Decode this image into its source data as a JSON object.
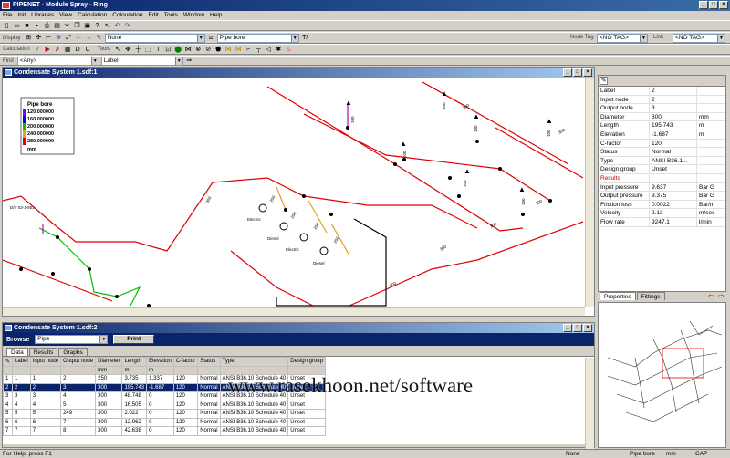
{
  "app": {
    "title": "PIPENET - Module Spray - Ring",
    "menu": [
      "File",
      "Init",
      "Libraries",
      "View",
      "Calculation",
      "Colouration",
      "Edit",
      "Tools",
      "Window",
      "Help"
    ]
  },
  "toolbar": {
    "display_label": "Display",
    "none_value": "None",
    "pipe_bore_value": "Pipe bore",
    "calculation_label": "Calculation",
    "tools_label": "Tools",
    "find_label": "Find",
    "any_value": "<Any>",
    "label_value": "Label",
    "node_tag_label": "Node Tag",
    "node_tag_value": "<NO TAG>",
    "link_label": "Link",
    "link_tag_value": "<NO TAG>"
  },
  "schematic": {
    "title": "Condensate System 1.sdf:1",
    "legend_title": "Pipe bore",
    "legend_values": [
      "120.000000",
      "160.000000",
      "200.000000",
      "240.000000",
      "280.000000"
    ],
    "legend_unit": "mm",
    "colors": {
      "red": "#e00000",
      "green": "#00c000",
      "orange": "#e0a020",
      "magenta": "#c000c0",
      "black": "#000000"
    },
    "labels": [
      "Electric",
      "Diesel",
      "Electric",
      "Diesel",
      "D/V 03-1-801"
    ],
    "pipe_numbers": [
      "300",
      "250",
      "250",
      "250",
      "250",
      "300",
      "300",
      "300",
      "300",
      "300",
      "300",
      "100",
      "100",
      "100",
      "100",
      "100",
      "100",
      "100"
    ]
  },
  "properties": {
    "rows": [
      {
        "k": "Label",
        "v": "2",
        "u": ""
      },
      {
        "k": "Input node",
        "v": "2",
        "u": ""
      },
      {
        "k": "Output node",
        "v": "3",
        "u": ""
      },
      {
        "k": "Diameter",
        "v": "300",
        "u": "mm"
      },
      {
        "k": "Length",
        "v": "195.743",
        "u": "m"
      },
      {
        "k": "Elevation",
        "v": "-1.687",
        "u": "m"
      },
      {
        "k": "C-factor",
        "v": "120",
        "u": ""
      },
      {
        "k": "Status",
        "v": "Normal",
        "u": ""
      },
      {
        "k": "Type",
        "v": "ANSI B36.1...",
        "u": ""
      },
      {
        "k": "Design group",
        "v": "Unset",
        "u": ""
      }
    ],
    "results_header": "Results",
    "results": [
      {
        "k": "Input pressure",
        "v": "9.637",
        "u": "Bar G"
      },
      {
        "k": "Output pressure",
        "v": "9.375",
        "u": "Bar G"
      },
      {
        "k": "Friction loss",
        "v": "0.0022",
        "u": "Bar/m"
      },
      {
        "k": "Velocity",
        "v": "2.13",
        "u": "m/sec"
      },
      {
        "k": "Flow rate",
        "v": "9247.1",
        "u": "l/min"
      }
    ],
    "tab_properties": "Properties",
    "tab_fittings": "Fittings"
  },
  "table_window": {
    "title": "Condensate System 1.sdf:2",
    "browse_label": "Browse",
    "browse_value": "Pipe",
    "print_label": "Print",
    "tabs": [
      "Data",
      "Results",
      "Graphs"
    ],
    "columns": [
      "Label",
      "Input node",
      "Output node",
      "Diameter",
      "Length",
      "Elevation",
      "C-factor",
      "Status",
      "Type",
      "Design group"
    ],
    "units": [
      "",
      "",
      "",
      "mm",
      "m",
      "m",
      "",
      "",
      "",
      ""
    ],
    "rows": [
      [
        "1",
        "1",
        "2",
        "250",
        "3.735",
        "1.337",
        "120",
        "Normal",
        "ANSI B36.10 Schedule 40",
        "Unset"
      ],
      [
        "2",
        "2",
        "3",
        "300",
        "195.743",
        "-1.687",
        "120",
        "Normal",
        "ANSI B36.10 Schedule 40",
        "Unset"
      ],
      [
        "3",
        "3",
        "4",
        "300",
        "48.748",
        "0",
        "120",
        "Normal",
        "ANSI B36.10 Schedule 40",
        "Unset"
      ],
      [
        "4",
        "4",
        "5",
        "300",
        "16.505",
        "0",
        "120",
        "Normal",
        "ANSI B36.10 Schedule 40",
        "Unset"
      ],
      [
        "5",
        "5",
        "249",
        "300",
        "2.022",
        "0",
        "120",
        "Normal",
        "ANSI B36.10 Schedule 40",
        "Unset"
      ],
      [
        "6",
        "6",
        "7",
        "300",
        "12.962",
        "0",
        "120",
        "Normal",
        "ANSI B36.10 Schedule 40",
        "Unset"
      ],
      [
        "7",
        "7",
        "8",
        "300",
        "42.638",
        "0",
        "120",
        "Normal",
        "ANSI B36.10 Schedule 40",
        "Unset"
      ]
    ]
  },
  "watermark": "www.rasekhoon.net/software",
  "status": {
    "help": "For Help, press F1",
    "none": "None",
    "pipe_bore": "Pipe bore",
    "mm": "mm",
    "cap": "CAP"
  }
}
